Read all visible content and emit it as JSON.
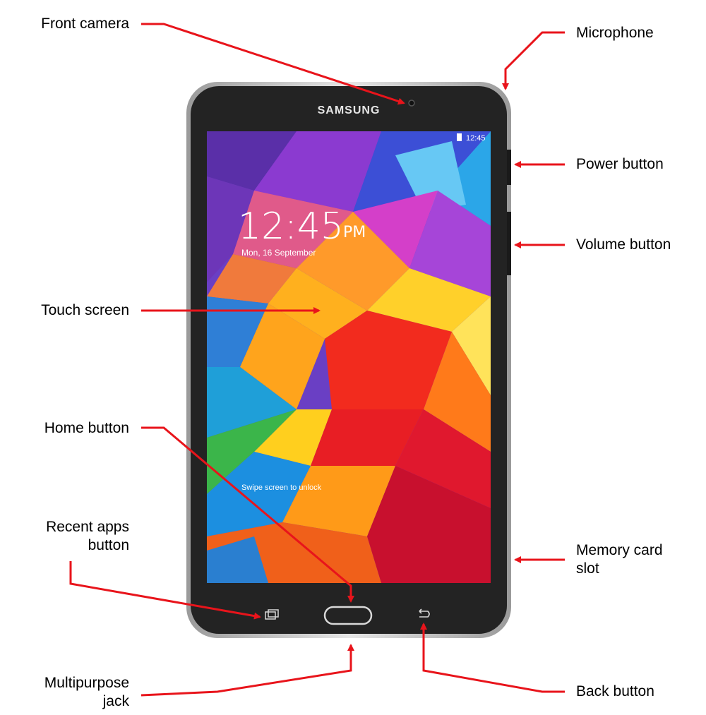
{
  "device": {
    "brand": "SAMSUNG",
    "status_time": "12:45",
    "lock_time": "12:45",
    "lock_ampm": "PM",
    "lock_date": "Mon, 16 September",
    "unlock_hint": "Swipe screen to unlock"
  },
  "callouts": {
    "front_camera": "Front camera",
    "microphone": "Microphone",
    "power_button": "Power button",
    "volume_button": "Volume button",
    "touch_screen": "Touch screen",
    "home_button": "Home button",
    "recent_apps_1": "Recent apps",
    "recent_apps_2": "button",
    "memory_card_1": "Memory card",
    "memory_card_2": "slot",
    "multipurpose_1": "Multipurpose",
    "multipurpose_2": "jack",
    "back_button": "Back button"
  },
  "colors": {
    "arrow": "#e8141b",
    "bezel": "#232323",
    "frame": "#c9c9c9"
  }
}
